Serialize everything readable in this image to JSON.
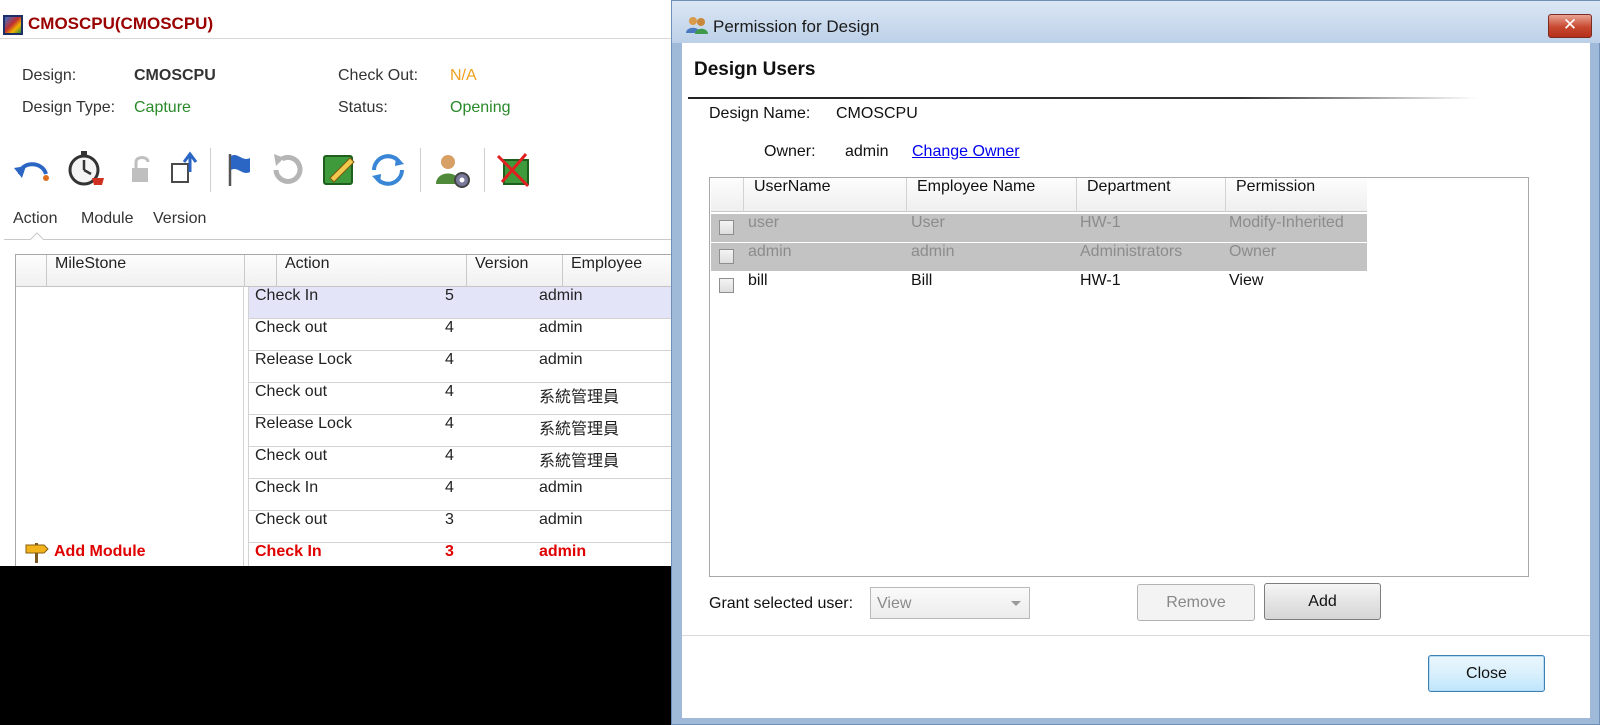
{
  "app": {
    "title": "CMOSCPU(CMOSCPU)",
    "info": {
      "design_label": "Design:",
      "design_value": "CMOSCPU",
      "design_type_label": "Design Type:",
      "design_type_value": "Capture",
      "checkout_label": "Check Out:",
      "checkout_value": "N/A",
      "status_label": "Status:",
      "status_value": "Opening"
    },
    "toolbar_icons": [
      "undo-icon",
      "timer-cart-icon",
      "lock-icon",
      "upload-icon",
      "flag-icon",
      "refresh-gray-icon",
      "edit-design-icon",
      "sync-icon",
      "user-settings-icon",
      "delete-design-icon"
    ],
    "tabs": [
      "Action",
      "Module",
      "Version"
    ],
    "grid": {
      "columns": [
        "MileStone",
        "Action",
        "Version",
        "Employee"
      ],
      "rows": [
        {
          "action": "Check In",
          "version": "5",
          "employee": "admin",
          "selected": true
        },
        {
          "action": "Check out",
          "version": "4",
          "employee": "admin"
        },
        {
          "action": "Release Lock",
          "version": "4",
          "employee": "admin"
        },
        {
          "action": "Check out",
          "version": "4",
          "employee": "系統管理員"
        },
        {
          "action": "Release Lock",
          "version": "4",
          "employee": "系統管理員"
        },
        {
          "action": "Check out",
          "version": "4",
          "employee": "系統管理員"
        },
        {
          "action": "Check In",
          "version": "4",
          "employee": "admin"
        },
        {
          "action": "Check out",
          "version": "3",
          "employee": "admin"
        },
        {
          "action": "Check In",
          "version": "3",
          "employee": "admin",
          "highlight": "red"
        }
      ],
      "milestone_label": "Add Module"
    }
  },
  "dialog": {
    "title": "Permission for Design",
    "heading": "Design Users",
    "design_name_label": "Design Name:",
    "design_name_value": "CMOSCPU",
    "owner_label": "Owner:",
    "owner_value": "admin",
    "change_owner_link": "Change Owner",
    "users_table": {
      "columns": [
        "UserName",
        "Employee Name",
        "Department",
        "Permission"
      ],
      "rows": [
        {
          "username": "user",
          "employee_name": "User",
          "department": "HW-1",
          "permission": "Modify-Inherited",
          "disabled": true
        },
        {
          "username": "admin",
          "employee_name": "admin",
          "department": "Administrators",
          "permission": "Owner",
          "disabled": true
        },
        {
          "username": "bill",
          "employee_name": "Bill",
          "department": "HW-1",
          "permission": "View",
          "disabled": false
        }
      ]
    },
    "grant_label": "Grant selected user:",
    "grant_value": "View",
    "remove_button": "Remove",
    "add_button": "Add",
    "close_button": "Close"
  },
  "colors": {
    "app_title": "#9a0000",
    "checkout_value": "#f0a020",
    "status_value": "#2a8a2a",
    "design_type_value": "#2a8a2a",
    "selected_row": "#e3e4f7",
    "link": "#0000ee",
    "disabled_row": "#c3c3c3"
  }
}
